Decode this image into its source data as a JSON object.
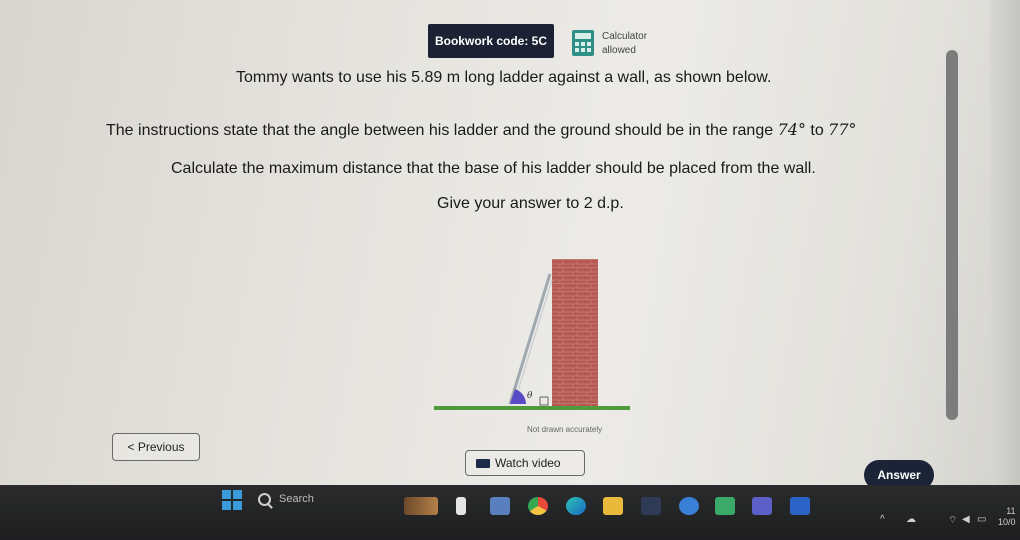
{
  "header": {
    "bookwork_code": "Bookwork code: 5C",
    "calculator_line1": "Calculator",
    "calculator_line2": "allowed"
  },
  "question": {
    "line1": "Tommy wants to use his 5.89 m long ladder against a wall, as shown below.",
    "line2_text": "The instructions state that the angle between his ladder and the ground should be in the range ",
    "range_low": "74°",
    "range_to": " to ",
    "range_high": "77°",
    "line3": "Calculate the maximum distance that the base of his ladder should be placed from the wall.",
    "line4": "Give your answer to 2 d.p."
  },
  "diagram": {
    "angle_label": "θ",
    "caption": "Not drawn accurately",
    "colors": {
      "wall": "#b55a52",
      "ground": "#4e9a3c",
      "ladder": "#a0a8b0",
      "angle": "#5a4cc4"
    }
  },
  "nav": {
    "previous_label": "< Previous",
    "watch_video_label": "Watch video",
    "answer_label": "Answer"
  },
  "taskbar": {
    "search_label": "Search",
    "clock_time": "11",
    "clock_date": "10/0"
  }
}
